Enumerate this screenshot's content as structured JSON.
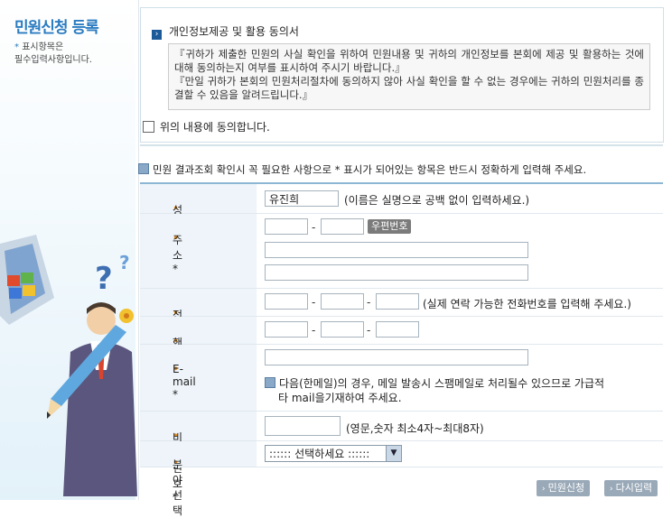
{
  "sidebar": {
    "title": "민원신청 등록",
    "note_star": "*",
    "note_line1": "표시항목은",
    "note_line2": "필수입력사항입니다."
  },
  "consent": {
    "heading": "개인정보제공 및 활용 동의서",
    "paragraph1": "『귀하가 제출한 민원의 사실 확인을 위하여 민원내용 및 귀하의 개인정보를 본회에 제공 및 활용하는 것에 대해 동의하는지 여부를 표시하여 주시기 바랍니다.』",
    "paragraph2": "『만일 귀하가 본회의 민원처리절차에 동의하지 않아 사실 확인을 할 수 없는 경우에는 귀하의 민원처리를 종결할 수 있음을 알려드립니다.』",
    "agree_label": "위의 내용에 동의합니다."
  },
  "notice": "민원 결과조회 확인시 꼭 필요한 사항으로 * 표시가 되어있는 항목은 반드시 정확하게 입력해 주세요.",
  "form": {
    "name": {
      "label": "성명 *",
      "value": "유진희",
      "hint": "(이름은 실명으로 공백 없이 입력하세요.)"
    },
    "address": {
      "label": "주소 *",
      "zip_button": "우편번호",
      "dash": "-"
    },
    "phone": {
      "label": "전화번호 *",
      "hint": "(실제 연락 가능한 전화번호를 입력해 주세요.)",
      "dash": "-"
    },
    "mobile": {
      "label": "핸드폰번호 *",
      "dash": "-"
    },
    "email": {
      "label": "E-mail *",
      "hint_line1": "다음(한메일)의 경우, 메일 발송시 스팸메일로 처리될수 있으므로 가급적",
      "hint_line2": "타 mail을기재하여 주세요."
    },
    "password": {
      "label": "비밀번호 *",
      "hint": "(영문,숫자 최소4자~최대8자)"
    },
    "category": {
      "label": "분야선택",
      "selected": ":::::: 선택하세요 ::::::"
    }
  },
  "buttons": {
    "submit": "민원신청",
    "reset": "다시입력"
  },
  "colors": {
    "accent": "#2b7cc1",
    "label_bg": "#eef4f9",
    "border": "#8cb6d4"
  }
}
